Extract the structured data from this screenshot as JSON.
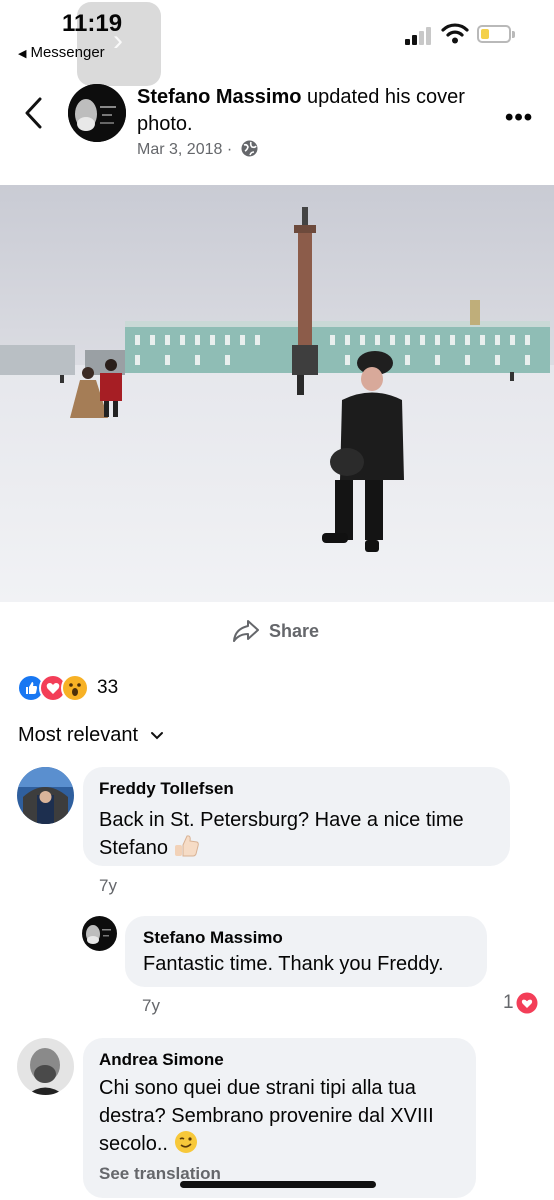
{
  "status_bar": {
    "time": "11:19",
    "back_app": "Messenger"
  },
  "post": {
    "author": "Stefano Massimo",
    "action": "updated his cover photo.",
    "date": "Mar 3, 2018 ·",
    "share_label": "Share",
    "reaction_count": "33"
  },
  "comments": {
    "sort_label": "Most relevant",
    "items": [
      {
        "name": "Freddy Tollefsen",
        "text_line1": "Back in St. Petersburg? Have a nice time",
        "text_line2": "Stefano",
        "time": "7y"
      },
      {
        "name": "Stefano Massimo",
        "text": "Fantastic time. Thank you Freddy.",
        "time": "7y",
        "likes": "1"
      },
      {
        "name": "Andrea Simone",
        "text_line1": "Chi sono quei due strani tipi alla tua",
        "text_line2": "destra? Sembrano provenire dal XVIII",
        "text_line3": "secolo..",
        "see_translation": "See translation"
      }
    ]
  },
  "colors": {
    "accent": "#1877f2",
    "bubble": "#f0f2f5",
    "meta": "#65676b",
    "love": "#f33e58"
  }
}
